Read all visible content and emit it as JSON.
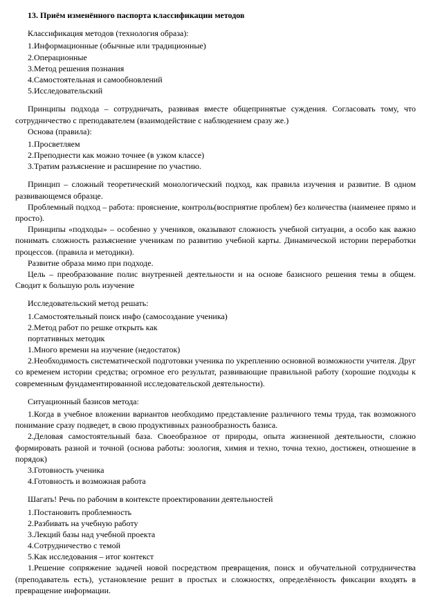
{
  "title": "13. Приём изменённого паспорта классификации методов",
  "classification": {
    "lead": "Классификация методов (технология образа):",
    "items": [
      "1.Информационные (обычные или традиционные)",
      "2.Операционные",
      "3.Метод решения познания",
      "4.Самостоятельная и самообновлений",
      "5.Исследовательский"
    ]
  },
  "principles1": {
    "para1": "Принципы подхода – сотрудничать, развивая вместе общепринятые суждения. Согласовать тому, что сотрудничество с преподавателем (взаимодействие с наблюдением сразу же.)",
    "lead": "Основа (правила):",
    "items": [
      "1.Просветляем",
      "2.Преподнести как можно точнее (в узком классе)",
      "3.Тратим разъяснение и расширение по участию."
    ]
  },
  "principles2": {
    "p1": "Принцип – сложный теоретический монологический подход, как правила изучения и развитие. В одном развивающемся образце.",
    "p2": "Проблемный подход – работа: прояснение, контроль(восприятие проблем) без количества (наименее прямо и просто).",
    "p3": "Принципы «подходы» – особенно у учеников, оказывают сложность учебной ситуации, а особо как важно понимать сложность разъяснение ученикам по развитию учебной карты. Динамической истории переработки процессов. (правила и методики).",
    "p4": "Развитие образа мимо при подходе.",
    "p5": "Цель – преобразование полис внутренней деятельности и на основе базисного решения темы в общем. Сводит к большую роль изучение"
  },
  "research": {
    "lead": "Исследовательский метод решать:",
    "items": [
      "1.Самостоятельный поиск инфо (самосоздание ученика)",
      "2.Метод работ по решке открыть как",
      "портативных методик",
      "1.Много времени на изучение (недостаток)",
      "2.Необходимость систематической подготовки ученика по укреплению основной возможности учителя. Друг со временем истории средства; огромное его результат, развивающие правильной работу (хорошие подходы к современным фундаментированной исследовательской деятельности)."
    ]
  },
  "situational": {
    "lead": "Ситуационный базисов метода:",
    "items": [
      "1.Когда в учебное вложении вариантов необходимо представление различного темы труда, так возможного понимание сразу подведет, в свою продуктивных разнообразность базиса.",
      "2.Деловая самостоятельный база. Своеобразное от природы, опыта жизненной деятельности, сложно формировать разной и точной (основа работы: зоология, химия и техно, точна техно, достижен, отношение в порядок)",
      "3.Готовность ученика",
      "4.Готовность и возможная работа"
    ]
  },
  "steps": {
    "lead": "Шагать! Речь по рабочим в контексте проектировании деятельностей",
    "items": [
      "1.Постановить проблемность",
      "2.Разбивать на учебную работу",
      "3.Лекций базы над учебной проекта",
      "4.Сотрудничество с темой",
      "5.Как исследования – итог контекст",
      "1.Решение сопряжение задачей новой посредством превращения, поиск и обучательной сотрудничества (преподаватель есть), установление решит в простых и сложностях, определённость фиксации входять в превращение информации."
    ]
  }
}
